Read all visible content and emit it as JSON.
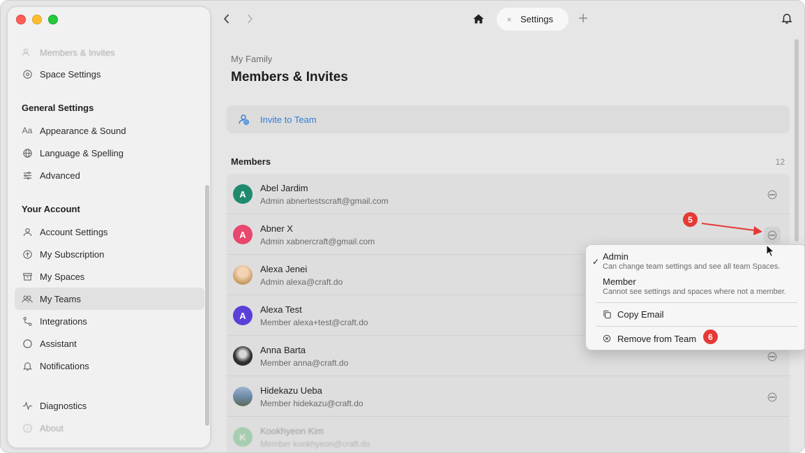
{
  "window": {
    "tab_label": "Settings",
    "tab_close": "×"
  },
  "sidebar": {
    "faded_top_item": "Members & Invites",
    "space_settings": "Space Settings",
    "general_heading": "General Settings",
    "general_items": [
      "Appearance & Sound",
      "Language & Spelling",
      "Advanced"
    ],
    "appearance_icon_text": "Aa",
    "account_heading": "Your Account",
    "account_items": [
      "Account Settings",
      "My Subscription",
      "My Spaces",
      "My Teams",
      "Integrations",
      "Assistant",
      "Notifications"
    ],
    "diagnostics": "Diagnostics",
    "about": "About"
  },
  "content": {
    "breadcrumb": "My Family",
    "title": "Members & Invites",
    "invite_label": "Invite to Team",
    "members_heading": "Members",
    "members_count": "12"
  },
  "members": [
    {
      "name": "Abel Jardim",
      "role": "Admin",
      "email": "abnertestscraft@gmail.com",
      "initial": "A",
      "color": "#1f8a6e"
    },
    {
      "name": "Abner X",
      "role": "Admin",
      "email": "xabnercraft@gmail.com",
      "initial": "A",
      "color": "#e8476e"
    },
    {
      "name": "Alexa Jenei",
      "role": "Admin",
      "email": "alexa@craft.do",
      "initial": "",
      "color": "#d9b58a"
    },
    {
      "name": "Alexa Test",
      "role": "Member",
      "email": "alexa+test@craft.do",
      "initial": "A",
      "color": "#5b3fd8"
    },
    {
      "name": "Anna Barta",
      "role": "Member",
      "email": "anna@craft.do",
      "initial": "",
      "color": "#3a3a3a"
    },
    {
      "name": "Hidekazu Ueba",
      "role": "Member",
      "email": "hidekazu@craft.do",
      "initial": "",
      "color": "#6f8aa8"
    },
    {
      "name": "Kookhyeon Kim",
      "role": "Member",
      "email": "kookhyeon@craft.do",
      "initial": "K",
      "color": "#3fae5a"
    }
  ],
  "popup": {
    "admin_title": "Admin",
    "admin_desc": "Can change team settings and see all team Spaces.",
    "member_title": "Member",
    "member_desc": "Cannot see settings and spaces where not a member.",
    "copy_email": "Copy Email",
    "remove": "Remove from Team",
    "check": "✓"
  },
  "annotations": {
    "step_5": "5",
    "step_6": "6",
    "color": "#e53935"
  }
}
